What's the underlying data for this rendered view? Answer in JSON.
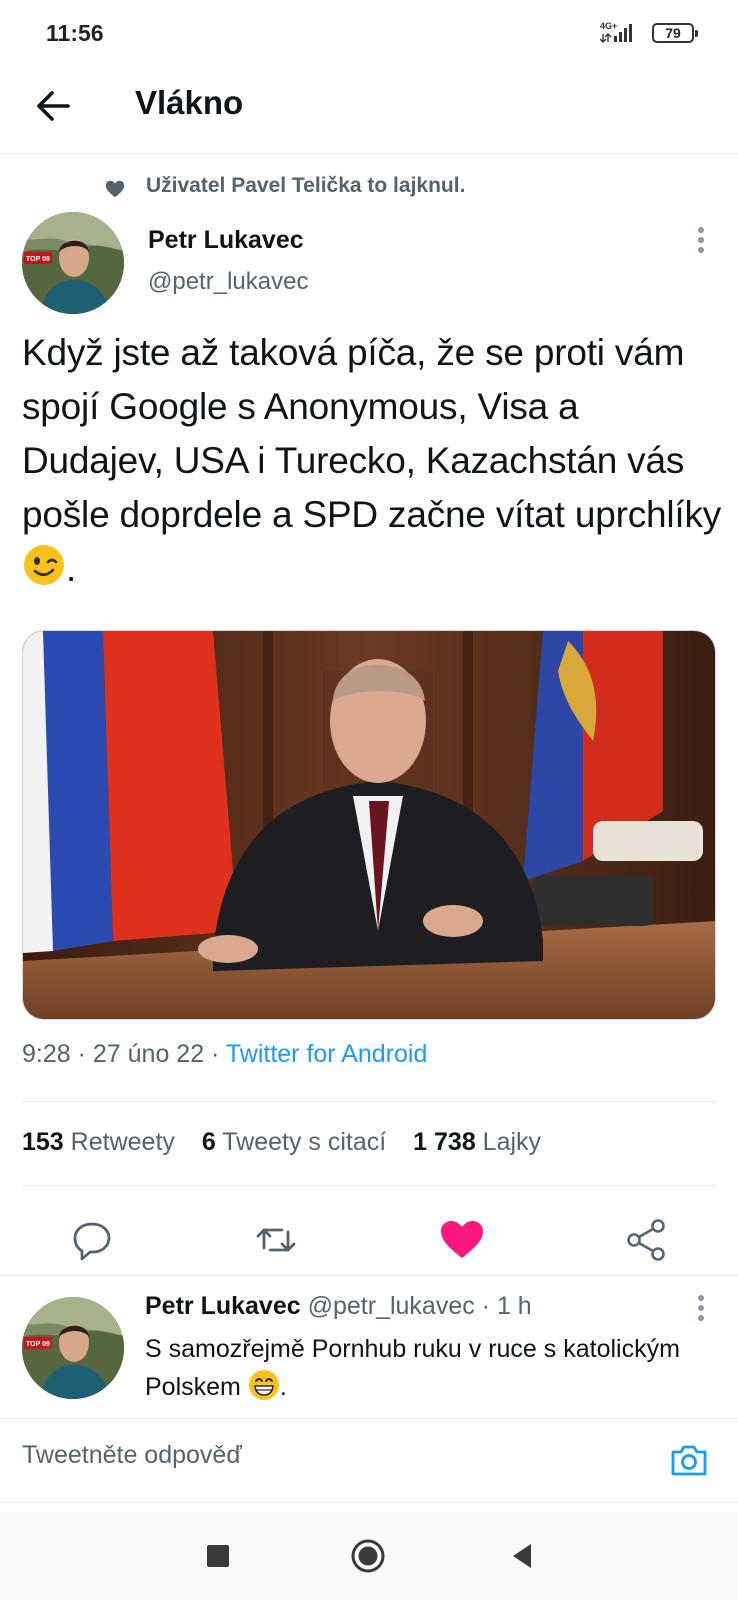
{
  "status_bar": {
    "time": "11:56",
    "network": "4G+",
    "battery": "79"
  },
  "header": {
    "title": "Vlákno"
  },
  "liked_by": {
    "text": "Uživatel Pavel Telička to lajknul."
  },
  "tweet": {
    "author_name": "Petr Lukavec",
    "author_handle": "@petr_lukavec",
    "avatar_badge": "TOP 09",
    "text": "Když jste až taková píča, že se proti vám spojí Google s Anonymous, Visa a Dudajev, USA i Turecko, Kazachstán vás pošle doprdele a SPD začne vítat uprchlíky",
    "text_end_emoji": "winking-face",
    "text_end_punct": ".",
    "time": "9:28",
    "sep1": " · ",
    "date": "27 úno 22",
    "sep2": " · ",
    "source": "Twitter for Android"
  },
  "stats": {
    "retweets": {
      "count": "153",
      "label": "Retweety"
    },
    "quotes": {
      "count": "6",
      "label": "Tweety s citací"
    },
    "likes": {
      "count": "1 738",
      "label": "Lajky"
    }
  },
  "colors": {
    "accent": "#1d9bf0",
    "like": "#f91880",
    "muted": "#536471",
    "text": "#0f1419"
  },
  "reply": {
    "author_name": "Petr Lukavec",
    "author_handle": "@petr_lukavec",
    "sep": " · ",
    "time": "1 h",
    "text": "S samozřejmě Pornhub ruku v ruce s katolickým Polskem",
    "text_end_emoji": "grinning-face",
    "text_end_punct": "."
  },
  "compose": {
    "placeholder": "Tweetněte odpověď"
  }
}
